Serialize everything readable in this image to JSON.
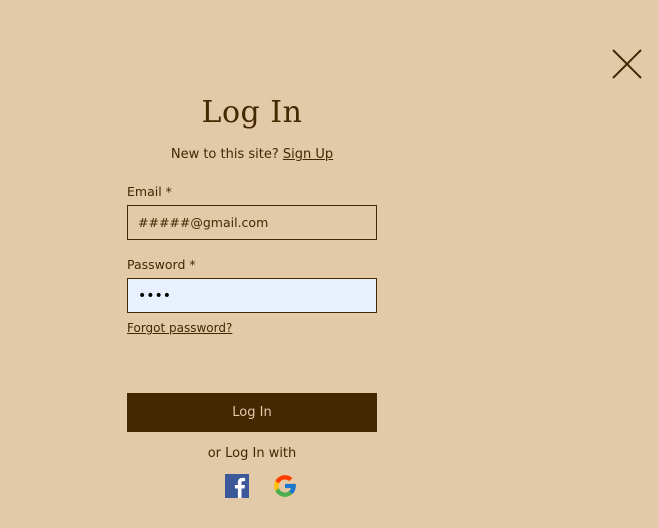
{
  "modal": {
    "close_icon": "close-x-icon",
    "title": "Log In",
    "subtitle_text": "New to this site?",
    "signup_link": "Sign Up"
  },
  "form": {
    "email": {
      "label": "Email *",
      "value": "#####@gmail.com"
    },
    "password": {
      "label": "Password *",
      "value": "••••"
    },
    "forgot_link": "Forgot password?",
    "submit_label": "Log In"
  },
  "social": {
    "or_text": "or Log In with",
    "providers": [
      {
        "name": "facebook-icon"
      },
      {
        "name": "google-icon"
      }
    ]
  },
  "colors": {
    "background": "#e2c9a8",
    "primary": "#432800",
    "autofill": "#e8f0fe",
    "facebook": "#3b5998"
  }
}
